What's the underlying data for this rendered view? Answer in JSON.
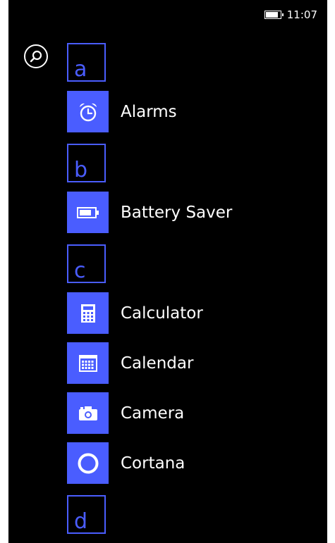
{
  "status_bar": {
    "time": "11:07"
  },
  "search": {
    "icon": "search-icon"
  },
  "groups": [
    {
      "letter": "a",
      "apps": [
        {
          "label": "Alarms",
          "icon": "alarm-clock-icon"
        }
      ]
    },
    {
      "letter": "b",
      "apps": [
        {
          "label": "Battery Saver",
          "icon": "battery-icon"
        }
      ]
    },
    {
      "letter": "c",
      "apps": [
        {
          "label": "Calculator",
          "icon": "calculator-icon"
        },
        {
          "label": "Calendar",
          "icon": "calendar-icon"
        },
        {
          "label": "Camera",
          "icon": "camera-icon"
        },
        {
          "label": "Cortana",
          "icon": "cortana-icon"
        }
      ]
    },
    {
      "letter": "d",
      "apps": []
    }
  ],
  "colors": {
    "accent": "#4a5dff",
    "background": "#000000",
    "text": "#ffffff"
  }
}
